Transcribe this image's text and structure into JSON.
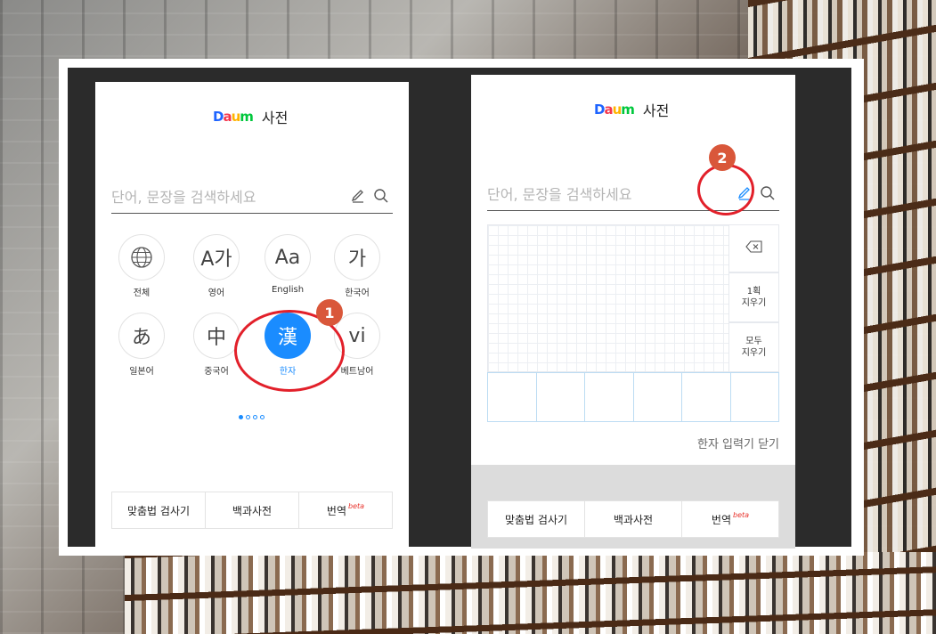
{
  "colors": {
    "daum_blue": "#1e64ff",
    "daum_red": "#f4364c",
    "daum_yellow": "#ffb400",
    "daum_green": "#00c73c",
    "accent": "#1a8cff",
    "marker": "#d9573a",
    "highlight_ring": "#e2202a"
  },
  "left_screen": {
    "logo": {
      "letters": [
        "D",
        "a",
        "u",
        "m"
      ]
    },
    "title": "사전",
    "search": {
      "placeholder": "단어, 문장을 검색하세요",
      "icons": [
        "pen-icon",
        "search-icon"
      ]
    },
    "languages": [
      {
        "symbol": "",
        "icon": "globe-icon",
        "label": "전체"
      },
      {
        "symbol": "A가",
        "label": "영어"
      },
      {
        "symbol": "Aa",
        "label": "English"
      },
      {
        "symbol": "가",
        "label": "한국어"
      },
      {
        "symbol": "あ",
        "label": "일본어"
      },
      {
        "symbol": "中",
        "label": "중국어"
      },
      {
        "symbol": "漢",
        "label": "한자",
        "selected": true
      },
      {
        "symbol": "vi",
        "label": "베트남어"
      }
    ],
    "page_dots": {
      "count": 4,
      "active": 1
    },
    "bottom_bar": {
      "spell_check": "맞춤법 검사기",
      "encyclopedia": "백과사전",
      "translate": "번역",
      "beta": "beta"
    },
    "marker": "1"
  },
  "right_screen": {
    "logo": {
      "letters": [
        "D",
        "a",
        "u",
        "m"
      ]
    },
    "title": "사전",
    "search": {
      "placeholder": "단어, 문장을 검색하세요",
      "icons": [
        "pen-icon",
        "search-icon"
      ]
    },
    "handwriting": {
      "delete_icon": "backspace-icon",
      "undo_stroke": [
        "1획",
        "지우기"
      ],
      "clear_all": [
        "모두",
        "지우기"
      ],
      "candidate_slots": 6
    },
    "close_hanja": "한자 입력기 닫기",
    "bottom_bar": {
      "spell_check": "맞춤법 검사기",
      "encyclopedia": "백과사전",
      "translate": "번역",
      "beta": "beta"
    },
    "marker": "2"
  }
}
